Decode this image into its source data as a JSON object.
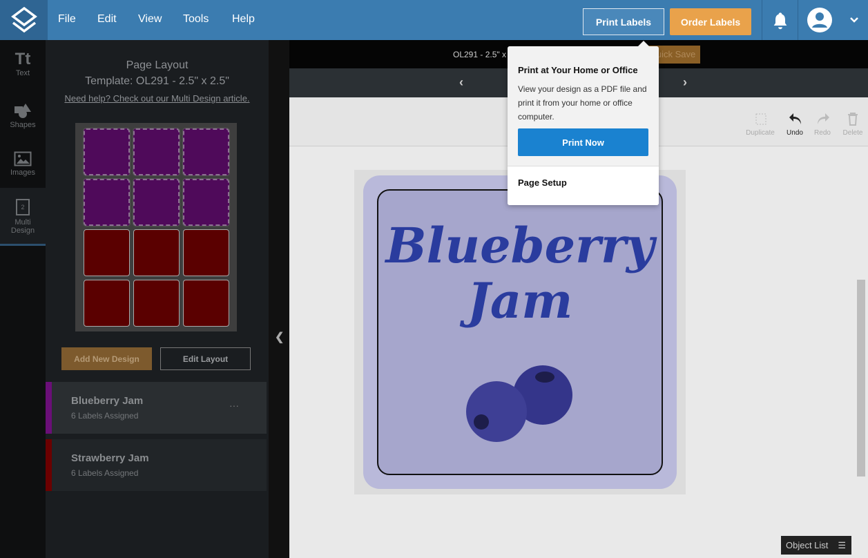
{
  "menu": {
    "items": [
      "File",
      "Edit",
      "View",
      "Tools",
      "Help"
    ]
  },
  "header": {
    "print_labels": "Print Labels",
    "order_labels": "Order Labels"
  },
  "rail": {
    "items": [
      "Text",
      "Shapes",
      "Images",
      "Multi Design"
    ],
    "text_glyph": "Tt",
    "multi_glyph": "2"
  },
  "panel": {
    "title": "Page Layout",
    "template": "Template: OL291 - 2.5\" x 2.5\"",
    "help_link": "Need help? Check out our Multi Design article.",
    "add_new_design": "Add New Design",
    "edit_layout": "Edit Layout",
    "designs": [
      {
        "name": "Blueberry Jam",
        "assigned": "6 Labels Assigned",
        "color": "#6a0f78",
        "more": "···"
      },
      {
        "name": "Strawberry Jam",
        "assigned": "6 Labels Assigned",
        "color": "#6b0000"
      }
    ]
  },
  "canvas": {
    "info": "OL291 - 2.5\" x",
    "quick_save": "Quick Save",
    "tools": [
      "Duplicate",
      "Undo",
      "Redo",
      "Delete"
    ],
    "label_text_1": "Blueberry",
    "label_text_2": "Jam",
    "object_list": "Object List"
  },
  "popup": {
    "title": "Print at Your Home or Office",
    "desc": "View your design as a PDF file and print it from your home or office computer.",
    "print_now": "Print Now",
    "page_setup": "Page Setup"
  },
  "colors": {
    "brand": "#3b7cb0",
    "accent": "#e9a24b",
    "primary_button": "#1a82d0"
  }
}
